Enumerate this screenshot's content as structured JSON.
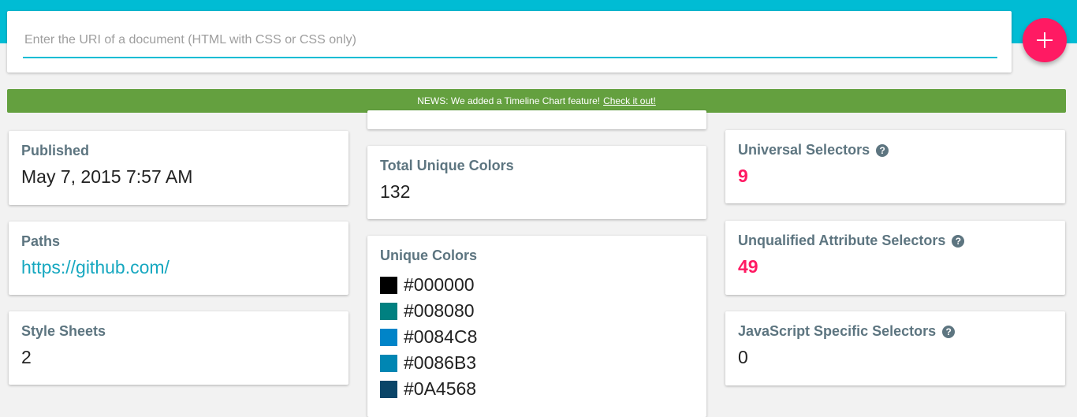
{
  "search": {
    "placeholder": "Enter the URI of a document (HTML with CSS or CSS only)",
    "add_button_icon": "plus-icon"
  },
  "news": {
    "text": "NEWS: We added a Timeline Chart feature!",
    "link_text": "Check it out!"
  },
  "left": {
    "published": {
      "label": "Published",
      "value": "May 7, 2015 7:57 AM"
    },
    "paths": {
      "label": "Paths",
      "value": "https://github.com/"
    },
    "style_sheets": {
      "label": "Style Sheets",
      "value": "2"
    }
  },
  "middle": {
    "total_unique_colors": {
      "label": "Total Unique Colors",
      "value": "132"
    },
    "unique_colors": {
      "label": "Unique Colors",
      "items": [
        {
          "code": "#000000",
          "color": "#000000"
        },
        {
          "code": "#008080",
          "color": "#008080"
        },
        {
          "code": "#0084C8",
          "color": "#0084C8"
        },
        {
          "code": "#0086B3",
          "color": "#0086B3"
        },
        {
          "code": "#0A4568",
          "color": "#0A4568"
        }
      ]
    }
  },
  "right": {
    "universal": {
      "label": "Universal Selectors",
      "value": "9"
    },
    "unqualified_attr": {
      "label": "Unqualified Attribute Selectors",
      "value": "49"
    },
    "js_specific": {
      "label": "JavaScript Specific Selectors",
      "value": "0"
    }
  },
  "colors": {
    "topbar": "#00bcd4",
    "accent": "#ff1a63",
    "news_bg": "#64a03f",
    "label": "#5d7580",
    "link": "#17a8c0"
  }
}
